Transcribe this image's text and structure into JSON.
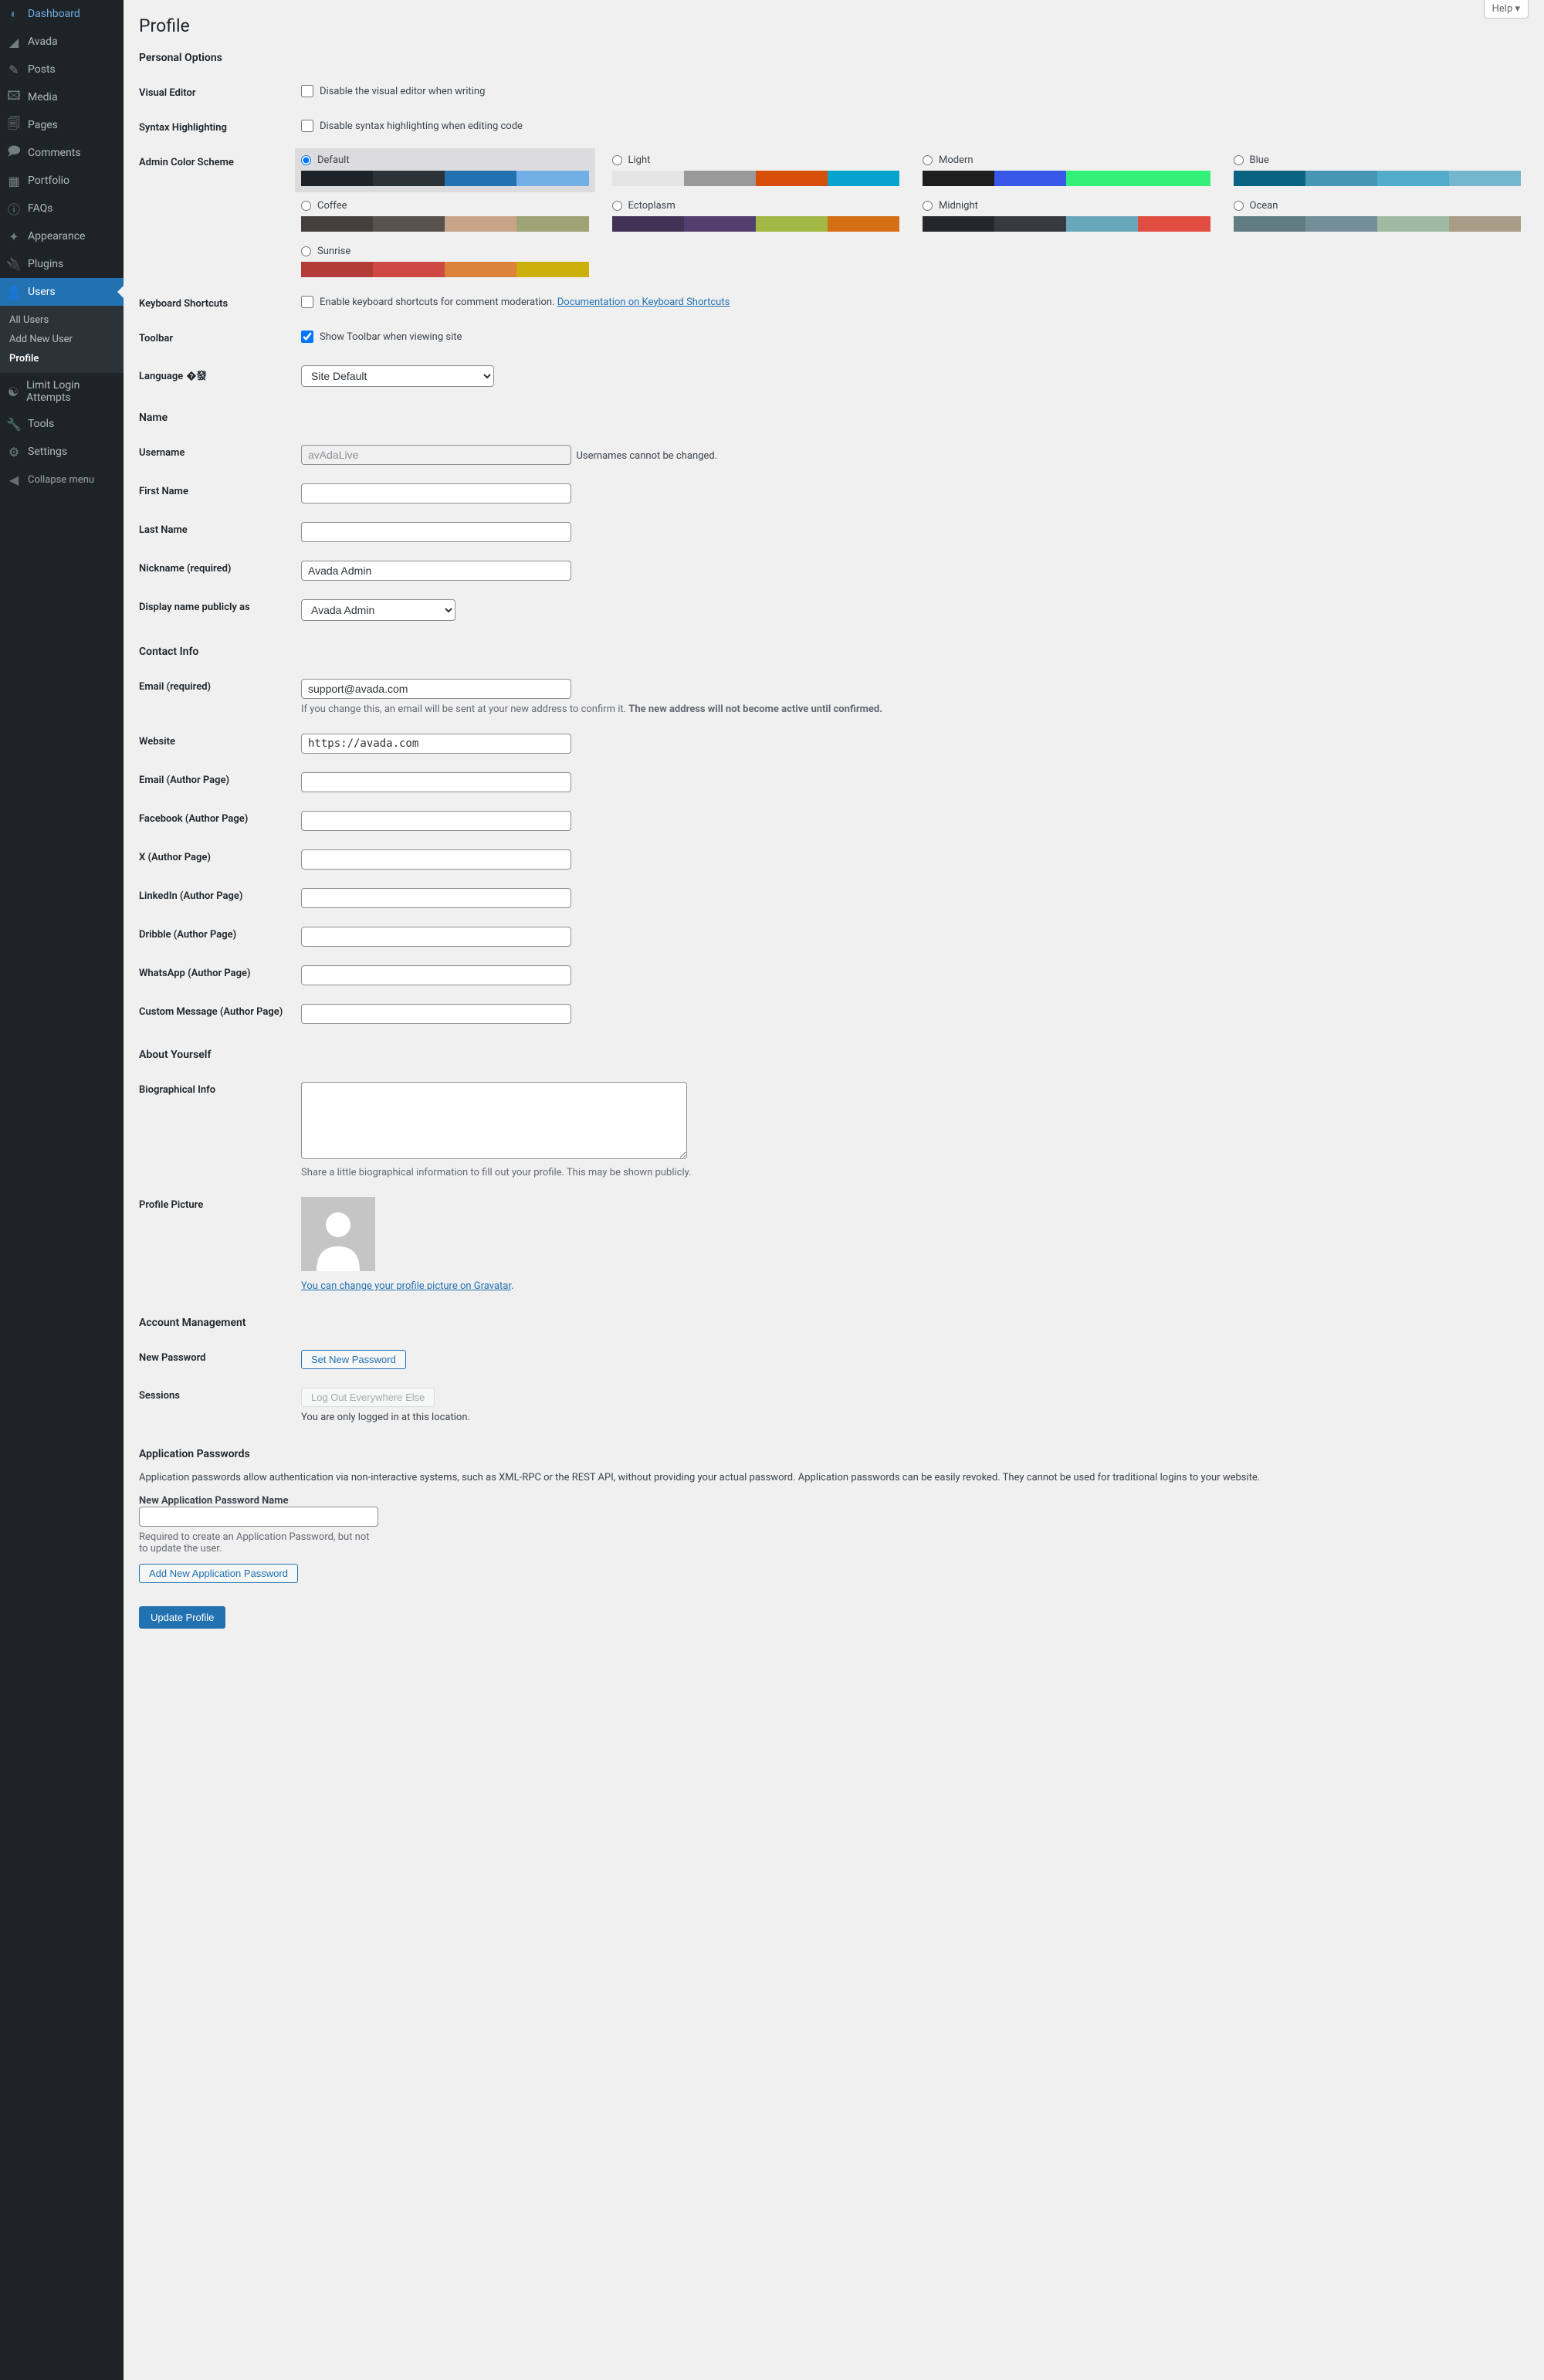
{
  "help_label": "Help ▾",
  "page_title": "Profile",
  "sidebar": {
    "items": [
      {
        "label": "Dashboard",
        "icon": "◐"
      },
      {
        "label": "Avada",
        "icon": "◢"
      },
      {
        "label": "Posts",
        "icon": "✎"
      },
      {
        "label": "Media",
        "icon": "🖾"
      },
      {
        "label": "Pages",
        "icon": "🗐"
      },
      {
        "label": "Comments",
        "icon": "🗩"
      },
      {
        "label": "Portfolio",
        "icon": "▦"
      },
      {
        "label": "FAQs",
        "icon": "ⓘ"
      },
      {
        "label": "Appearance",
        "icon": "✦"
      },
      {
        "label": "Plugins",
        "icon": "🔌"
      },
      {
        "label": "Users",
        "icon": "👤",
        "current": true
      },
      {
        "label": "Limit Login Attempts",
        "icon": "☯"
      },
      {
        "label": "Tools",
        "icon": "🔧"
      },
      {
        "label": "Settings",
        "icon": "⚙"
      }
    ],
    "submenu": [
      "All Users",
      "Add New User",
      "Profile"
    ],
    "collapse": "Collapse menu"
  },
  "sections": {
    "personal_options": "Personal Options",
    "name": "Name",
    "contact_info": "Contact Info",
    "about": "About Yourself",
    "account": "Account Management",
    "app_pw": "Application Passwords"
  },
  "fields": {
    "visual_editor": {
      "label": "Visual Editor",
      "cb": "Disable the visual editor when writing"
    },
    "syntax": {
      "label": "Syntax Highlighting",
      "cb": "Disable syntax highlighting when editing code"
    },
    "color_scheme": {
      "label": "Admin Color Scheme"
    },
    "keyboard": {
      "label": "Keyboard Shortcuts",
      "cb": "Enable keyboard shortcuts for comment moderation. ",
      "link": "Documentation on Keyboard Shortcuts"
    },
    "toolbar": {
      "label": "Toolbar",
      "cb": "Show Toolbar when viewing site"
    },
    "language": {
      "label": "Language",
      "value": "Site Default"
    },
    "username": {
      "label": "Username",
      "value": "avAdaLive",
      "note": "Usernames cannot be changed."
    },
    "first_name": {
      "label": "First Name"
    },
    "last_name": {
      "label": "Last Name"
    },
    "nickname": {
      "label": "Nickname (required)",
      "value": "Avada Admin"
    },
    "display_name": {
      "label": "Display name publicly as",
      "value": "Avada Admin"
    },
    "email": {
      "label": "Email (required)",
      "value": "support@avada.com",
      "note1": "If you change this, an email will be sent at your new address to confirm it. ",
      "note2": "The new address will not become active until confirmed."
    },
    "website": {
      "label": "Website",
      "value": "https://avada.com"
    },
    "email_author": {
      "label": "Email (Author Page)"
    },
    "facebook": {
      "label": "Facebook (Author Page)"
    },
    "x_author": {
      "label": "X (Author Page)"
    },
    "linkedin": {
      "label": "LinkedIn (Author Page)"
    },
    "dribble": {
      "label": "Dribble (Author Page)"
    },
    "whatsapp": {
      "label": "WhatsApp (Author Page)"
    },
    "custom_msg": {
      "label": "Custom Message (Author Page)"
    },
    "bio": {
      "label": "Biographical Info",
      "note": "Share a little biographical information to fill out your profile. This may be shown publicly."
    },
    "picture": {
      "label": "Profile Picture",
      "link": "You can change your profile picture on Gravatar"
    },
    "new_password": {
      "label": "New Password",
      "btn": "Set New Password"
    },
    "sessions": {
      "label": "Sessions",
      "btn": "Log Out Everywhere Else",
      "note": "You are only logged in at this location."
    },
    "app_pw_desc": "Application passwords allow authentication via non-interactive systems, such as XML-RPC or the REST API, without providing your actual password. Application passwords can be easily revoked. They cannot be used for traditional logins to your website.",
    "app_pw_name": {
      "label": "New Application Password Name",
      "note": "Required to create an Application Password, but not to update the user.",
      "btn": "Add New Application Password"
    }
  },
  "schemes": [
    {
      "name": "Default",
      "colors": [
        "#1d2327",
        "#2c3338",
        "#2271b1",
        "#72aee6"
      ],
      "sel": true
    },
    {
      "name": "Light",
      "colors": [
        "#e5e5e5",
        "#999999",
        "#d64e07",
        "#04a4cc"
      ]
    },
    {
      "name": "Modern",
      "colors": [
        "#1e1e1e",
        "#3858e9",
        "#33f078",
        "#33f078"
      ]
    },
    {
      "name": "Blue",
      "colors": [
        "#096484",
        "#4796b3",
        "#52accc",
        "#74B6CE"
      ]
    },
    {
      "name": "Coffee",
      "colors": [
        "#46403c",
        "#59524c",
        "#c7a589",
        "#9ea476"
      ]
    },
    {
      "name": "Ectoplasm",
      "colors": [
        "#413256",
        "#523f6d",
        "#a3b745",
        "#d46f15"
      ]
    },
    {
      "name": "Midnight",
      "colors": [
        "#25282b",
        "#363b3f",
        "#69a8bb",
        "#e14d43"
      ]
    },
    {
      "name": "Ocean",
      "colors": [
        "#627c83",
        "#738e96",
        "#9ebaa0",
        "#aa9d88"
      ]
    },
    {
      "name": "Sunrise",
      "colors": [
        "#b43c38",
        "#cf4944",
        "#dd823b",
        "#ccaf0b"
      ]
    }
  ],
  "update_btn": "Update Profile"
}
